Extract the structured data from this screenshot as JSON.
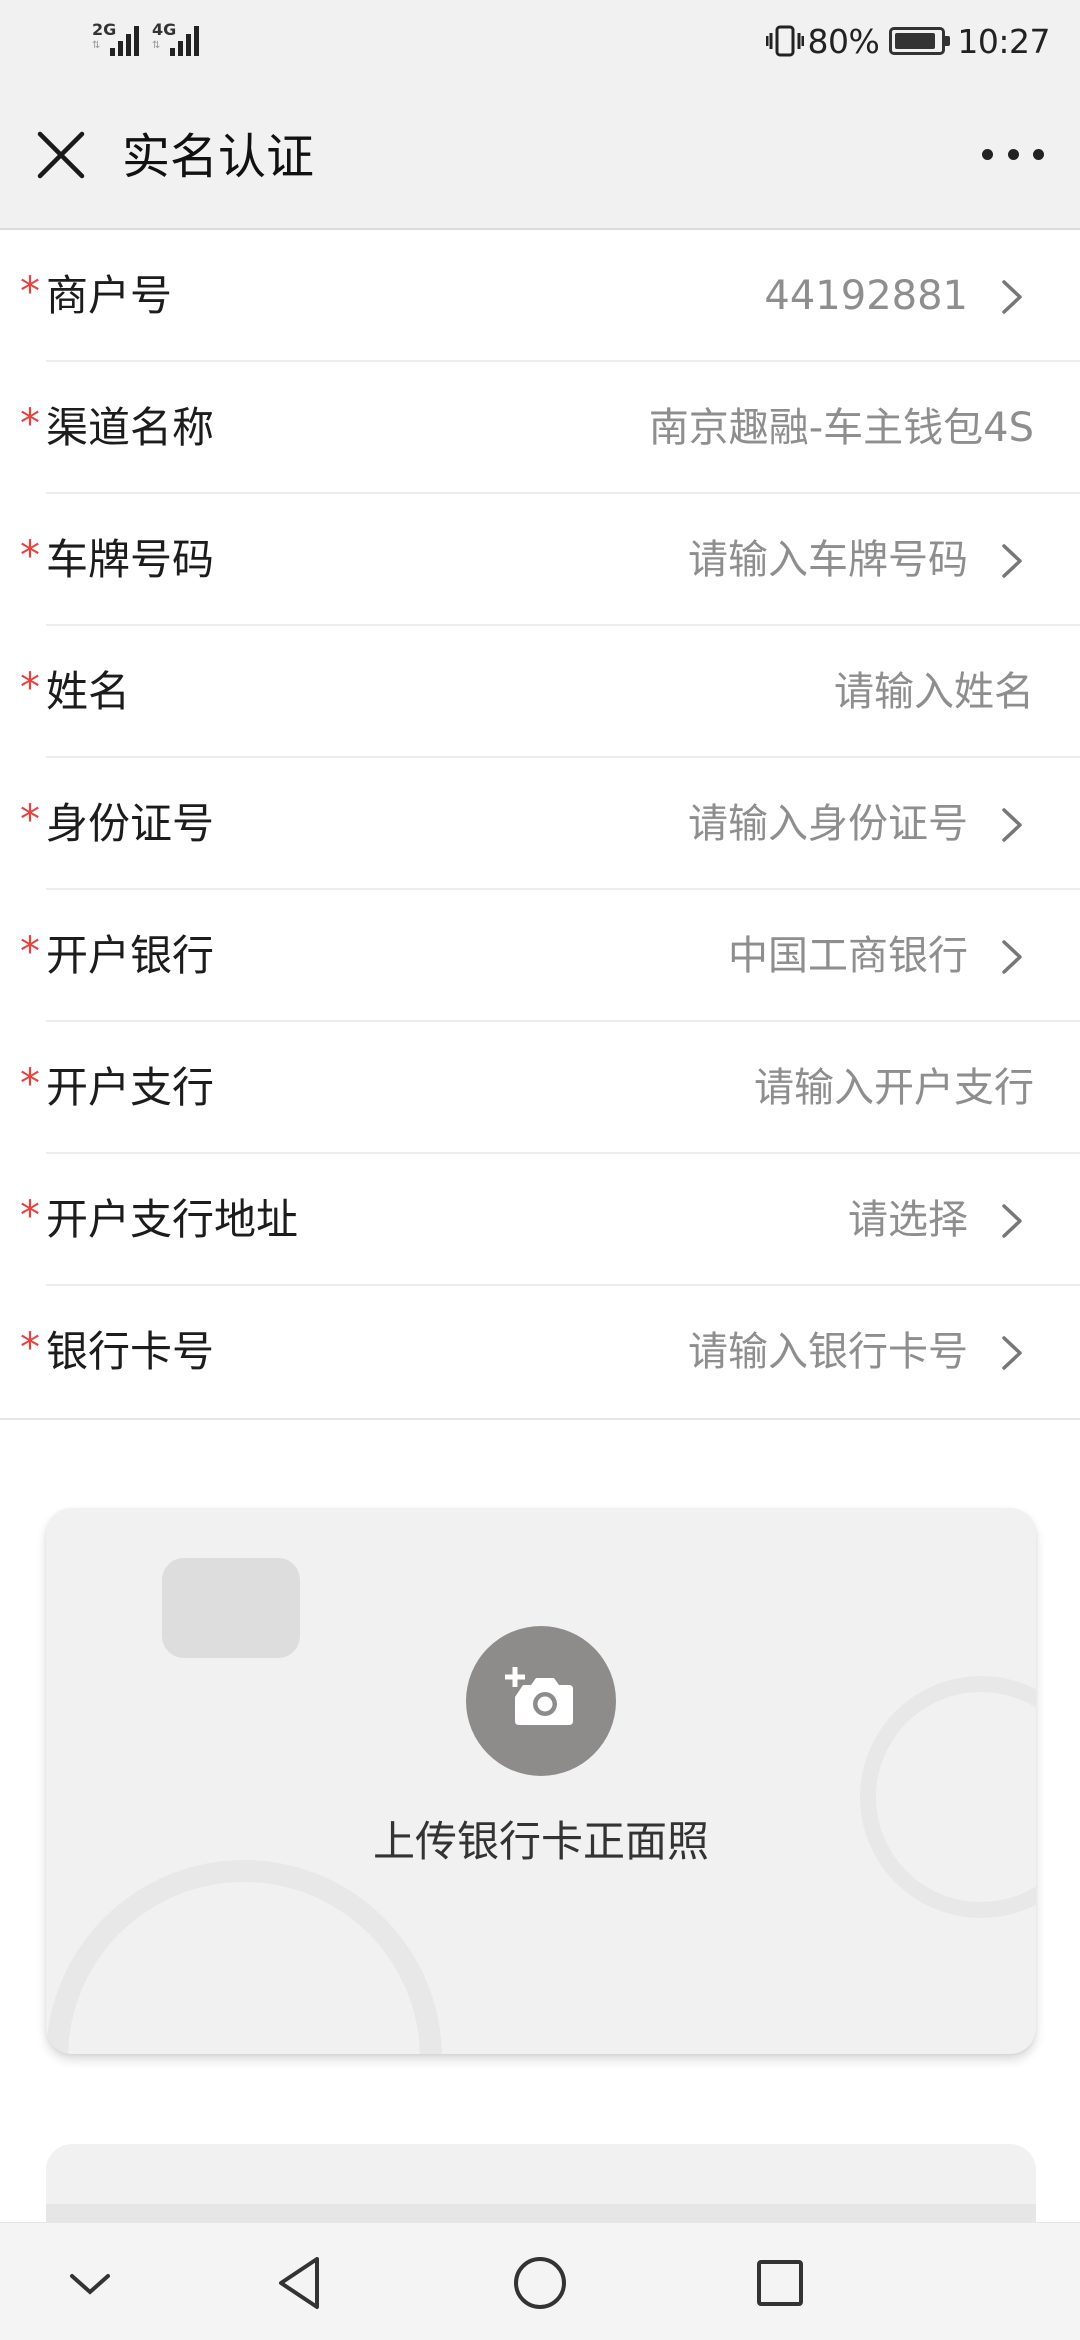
{
  "status_bar": {
    "signal1_label": "2G",
    "signal2_label": "4G",
    "battery_percent": "80%",
    "time": "10:27"
  },
  "nav": {
    "title": "实名认证"
  },
  "form": {
    "rows": [
      {
        "label": "商户号",
        "value": "44192881",
        "chevron": true
      },
      {
        "label": "渠道名称",
        "value": "南京趣融-车主钱包4S",
        "chevron": false
      },
      {
        "label": "车牌号码",
        "value": "请输入车牌号码",
        "chevron": true
      },
      {
        "label": "姓名",
        "value": "请输入姓名",
        "chevron": false
      },
      {
        "label": "身份证号",
        "value": "请输入身份证号",
        "chevron": true
      },
      {
        "label": "开户银行",
        "value": "中国工商银行",
        "chevron": true
      },
      {
        "label": "开户支行",
        "value": "请输入开户支行",
        "chevron": false
      },
      {
        "label": "开户支行地址",
        "value": "请选择",
        "chevron": true
      },
      {
        "label": "银行卡号",
        "value": "请输入银行卡号",
        "chevron": true
      }
    ],
    "required_mark": "*"
  },
  "upload": {
    "label": "上传银行卡正面照"
  },
  "colors": {
    "required": "#e64340",
    "placeholder": "#8e8e8e",
    "header_bg": "#f1f1f1"
  }
}
